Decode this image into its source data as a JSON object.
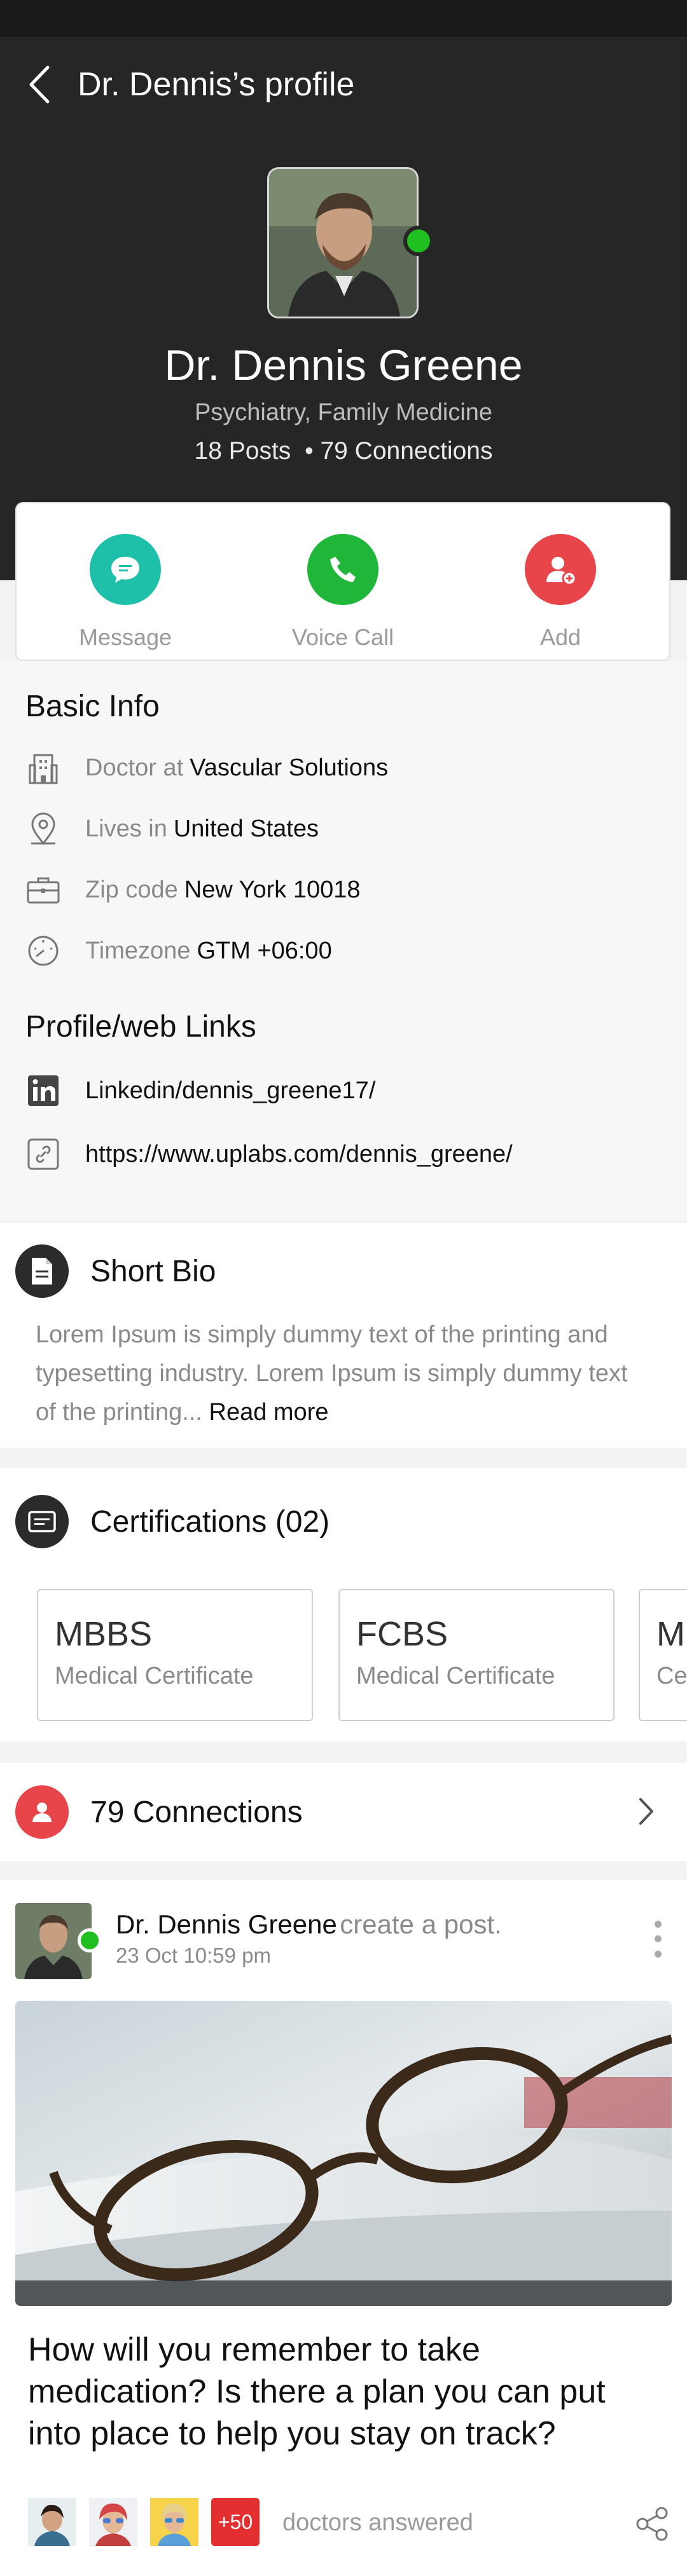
{
  "header": {
    "title": "Dr. Dennis’s profile",
    "name": "Dr. Dennis Greene",
    "specialty": "Psychiatry, Family Medicine",
    "stats": "18 Posts  • 79 Connections"
  },
  "actions": [
    {
      "label": "Message",
      "color": "#1fc0aa"
    },
    {
      "label": "Voice Call",
      "color": "#1fb63a"
    },
    {
      "label": "Add",
      "color": "#e8454b"
    }
  ],
  "basic_info": {
    "heading": "Basic Info",
    "rows": [
      {
        "muted": "Doctor at",
        "value": "Vascular Solutions",
        "icon": "building-icon"
      },
      {
        "muted": "Lives in",
        "value": "United States",
        "icon": "location-pin-icon"
      },
      {
        "muted": "Zip code",
        "value": "New York 10018",
        "icon": "briefcase-icon"
      },
      {
        "muted": "Timezone",
        "value": "GTM +06:00",
        "icon": "clock-icon"
      }
    ]
  },
  "links": {
    "heading": "Profile/web Links",
    "rows": [
      {
        "value": "Linkedin/dennis_greene17/",
        "icon": "linkedin-icon"
      },
      {
        "value": "https://www.uplabs.com/dennis_greene/",
        "icon": "link-icon"
      }
    ]
  },
  "bio": {
    "heading": "Short Bio",
    "text": "Lorem Ipsum is simply dummy text of the printing and typesetting industry. Lorem Ipsum is simply dummy text of the printing...",
    "read_more": "Read more"
  },
  "certifications": {
    "heading": "Certifications (02)",
    "items": [
      {
        "title": "MBBS",
        "subtitle": "Medical Certificate"
      },
      {
        "title": "FCBS",
        "subtitle": "Medical Certificate"
      },
      {
        "title": "MBBS",
        "subtitle": "Certificate"
      }
    ]
  },
  "connections": {
    "label": "79 Connections"
  },
  "post": {
    "author": "Dr. Dennis Greene",
    "action": "create a post.",
    "date": "23 Oct 10:59 pm",
    "question": "How will you remember to take medication? Is there a plan you can put into place to help you stay on track?",
    "badge": "+50",
    "answered": "doctors answered"
  }
}
